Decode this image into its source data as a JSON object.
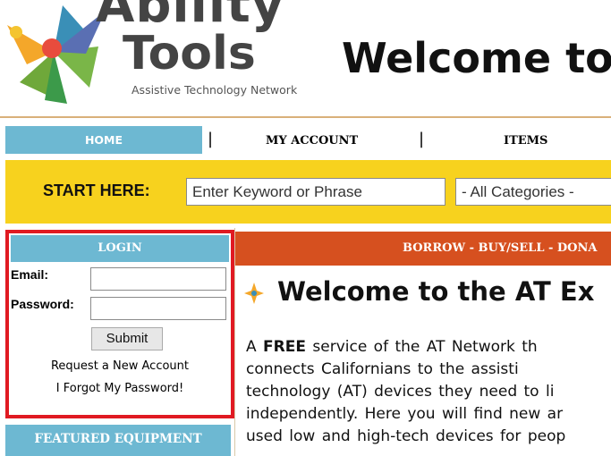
{
  "header": {
    "brand_line1": "Ability",
    "brand_line2": "Tools",
    "brand_subtitle": "Assistive Technology Network",
    "headline": "Welcome to"
  },
  "nav": {
    "items": [
      "HOME",
      "MY ACCOUNT",
      "ITEMS"
    ],
    "active": "HOME"
  },
  "search": {
    "label": "START HERE:",
    "placeholder": "Enter Keyword or Phrase",
    "category": "- All Categories -"
  },
  "login": {
    "heading": "LOGIN",
    "email_label": "Email:",
    "password_label": "Password:",
    "submit_label": "Submit",
    "new_account_link": "Request a New Account",
    "forgot_link": "I Forgot My Password!"
  },
  "sidebar": {
    "featured_heading": "FEATURED EQUIPMENT"
  },
  "main": {
    "banner": "BORROW - BUY/SELL - DONA",
    "title": "Welcome to the AT Ex",
    "paragraph_lines": [
      {
        "pre": "A ",
        "bold": "FREE",
        "post": " service of the AT Network th"
      },
      {
        "pre": "connects  Californians  to  the  assisti",
        "bold": "",
        "post": ""
      },
      {
        "pre": "technology (AT) devices they need to li",
        "bold": "",
        "post": ""
      },
      {
        "pre": "independently. Here you will find new ar",
        "bold": "",
        "post": ""
      },
      {
        "pre": "used low and high-tech devices for peop",
        "bold": "",
        "post": ""
      }
    ]
  },
  "colors": {
    "nav_blue": "#6db8d2",
    "search_yellow": "#f7d21e",
    "banner_orange": "#d6501f",
    "highlight_red": "#e01a22"
  }
}
